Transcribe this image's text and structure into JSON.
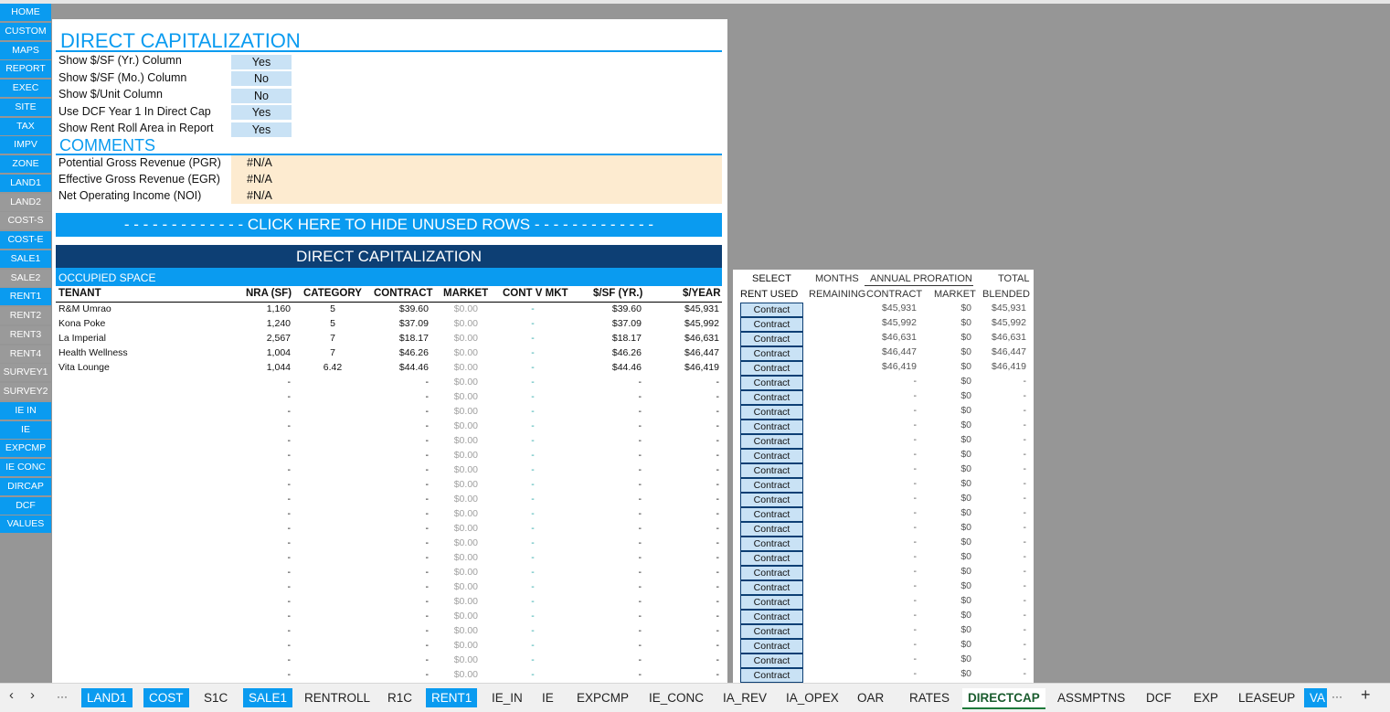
{
  "nav": [
    {
      "label": "HOME",
      "color": "blue"
    },
    {
      "label": "CUSTOM",
      "color": "blue"
    },
    {
      "label": "MAPS",
      "color": "blue"
    },
    {
      "label": "REPORT",
      "color": "blue"
    },
    {
      "label": "EXEC",
      "color": "blue"
    },
    {
      "label": "SITE",
      "color": "blue"
    },
    {
      "label": "TAX",
      "color": "blue"
    },
    {
      "label": "IMPV",
      "color": "blue"
    },
    {
      "label": "ZONE",
      "color": "blue"
    },
    {
      "label": "LAND1",
      "color": "blue"
    },
    {
      "label": "LAND2",
      "color": "gray"
    },
    {
      "label": "COST-S",
      "color": "gray"
    },
    {
      "label": "COST-E",
      "color": "blue"
    },
    {
      "label": "SALE1",
      "color": "blue"
    },
    {
      "label": "SALE2",
      "color": "gray"
    },
    {
      "label": "RENT1",
      "color": "blue"
    },
    {
      "label": "RENT2",
      "color": "gray"
    },
    {
      "label": "RENT3",
      "color": "gray"
    },
    {
      "label": "RENT4",
      "color": "gray"
    },
    {
      "label": "SURVEY1",
      "color": "gray"
    },
    {
      "label": "SURVEY2",
      "color": "gray"
    },
    {
      "label": "IE IN",
      "color": "blue"
    },
    {
      "label": "IE",
      "color": "blue"
    },
    {
      "label": "EXPCMP",
      "color": "blue"
    },
    {
      "label": "IE CONC",
      "color": "blue"
    },
    {
      "label": "DIRCAP",
      "color": "blue"
    },
    {
      "label": "DCF",
      "color": "blue"
    },
    {
      "label": "VALUES",
      "color": "blue"
    }
  ],
  "title": "DIRECT CAPITALIZATION",
  "options": [
    {
      "label": "Show $/SF (Yr.) Column",
      "value": "Yes"
    },
    {
      "label": "Show $/SF (Mo.) Column",
      "value": "No"
    },
    {
      "label": "Show $/Unit Column",
      "value": "No"
    },
    {
      "label": "Use DCF Year 1 In Direct Cap",
      "value": "Yes"
    },
    {
      "label": "Show Rent Roll Area in Report",
      "value": "Yes"
    }
  ],
  "comments_title": "COMMENTS",
  "comments": [
    {
      "label": "Potential Gross Revenue (PGR)",
      "value": "#N/A"
    },
    {
      "label": "Effective Gross Revenue (EGR)",
      "value": "#N/A"
    },
    {
      "label": "Net Operating Income (NOI)",
      "value": "#N/A"
    }
  ],
  "hide_button": "- - - - - - - - - - - - - CLICK HERE TO HIDE UNUSED ROWS - - - - - - - - - - - - -",
  "dc_header": "DIRECT CAPITALIZATION",
  "occupied_label": "OCCUPIED SPACE",
  "columns": {
    "tenant": "TENANT",
    "nra": "NRA (SF)",
    "category": "CATEGORY",
    "contract": "CONTRACT",
    "market": "MARKET",
    "cont_v_mkt": "CONT V MKT",
    "psf": "$/SF (YR.)",
    "per_year": "$/YEAR"
  },
  "tenants": [
    {
      "tenant": "R&M Umrao",
      "nra": "1,160",
      "category": "5",
      "contract": "$39.60",
      "market": "$0.00",
      "cont_v_mkt": "-",
      "psf": "$39.60",
      "per_year": "$45,931"
    },
    {
      "tenant": "Kona Poke",
      "nra": "1,240",
      "category": "5",
      "contract": "$37.09",
      "market": "$0.00",
      "cont_v_mkt": "-",
      "psf": "$37.09",
      "per_year": "$45,992"
    },
    {
      "tenant": "La Imperial",
      "nra": "2,567",
      "category": "7",
      "contract": "$18.17",
      "market": "$0.00",
      "cont_v_mkt": "-",
      "psf": "$18.17",
      "per_year": "$46,631"
    },
    {
      "tenant": "Health Wellness",
      "nra": "1,004",
      "category": "7",
      "contract": "$46.26",
      "market": "$0.00",
      "cont_v_mkt": "-",
      "psf": "$46.26",
      "per_year": "$46,447"
    },
    {
      "tenant": "Vita Lounge",
      "nra": "1,044",
      "category": "6.42",
      "contract": "$44.46",
      "market": "$0.00",
      "cont_v_mkt": "-",
      "psf": "$44.46",
      "per_year": "$46,419"
    }
  ],
  "empty_row": {
    "nra": "-",
    "contract": "-",
    "market": "$0.00",
    "cont_v_mkt": "-",
    "psf": "-",
    "per_year": "-"
  },
  "right_headers": {
    "select_rent": "SELECT",
    "rent_used": "RENT USED",
    "months": "MONTHS",
    "remaining": "REMAINING",
    "annual_proration": "ANNUAL PRORATION",
    "contract": "CONTRACT",
    "market": "MARKET",
    "total": "TOTAL",
    "blended": "BLENDED"
  },
  "right_rows": [
    {
      "btn": "Contract",
      "contract": "$45,931",
      "market": "$0",
      "blended": "$45,931"
    },
    {
      "btn": "Contract",
      "contract": "$45,992",
      "market": "$0",
      "blended": "$45,992"
    },
    {
      "btn": "Contract",
      "contract": "$46,631",
      "market": "$0",
      "blended": "$46,631"
    },
    {
      "btn": "Contract",
      "contract": "$46,447",
      "market": "$0",
      "blended": "$46,447"
    },
    {
      "btn": "Contract",
      "contract": "$46,419",
      "market": "$0",
      "blended": "$46,419"
    }
  ],
  "right_empty_row": {
    "btn": "Contract",
    "contract": "-",
    "market": "$0",
    "blended": "-"
  },
  "tabs": [
    {
      "label": "LAND1",
      "style": "blue"
    },
    {
      "label": "COST",
      "style": "blue"
    },
    {
      "label": "S1C",
      "style": "plain"
    },
    {
      "label": "SALE1",
      "style": "blue"
    },
    {
      "label": "RENTROLL",
      "style": "plain"
    },
    {
      "label": "R1C",
      "style": "plain"
    },
    {
      "label": "RENT1",
      "style": "blue"
    },
    {
      "label": "IE_IN",
      "style": "plain"
    },
    {
      "label": "IE",
      "style": "plain"
    },
    {
      "label": "EXPCMP",
      "style": "plain"
    },
    {
      "label": "IE_CONC",
      "style": "plain"
    },
    {
      "label": "IA_REV",
      "style": "plain"
    },
    {
      "label": "IA_OPEX",
      "style": "plain"
    },
    {
      "label": "OAR",
      "style": "plain"
    },
    {
      "label": "RATES",
      "style": "plain"
    },
    {
      "label": "DIRECTCAP",
      "style": "active"
    },
    {
      "label": "ASSMPTNS",
      "style": "plain"
    },
    {
      "label": "DCF",
      "style": "plain"
    },
    {
      "label": "EXP",
      "style": "plain"
    },
    {
      "label": "LEASEUP",
      "style": "plain"
    },
    {
      "label": "VA",
      "style": "blue"
    }
  ],
  "tab_nav": {
    "prev": "‹",
    "next": "›",
    "more": "···",
    "more_right": "···",
    "add": "+"
  }
}
